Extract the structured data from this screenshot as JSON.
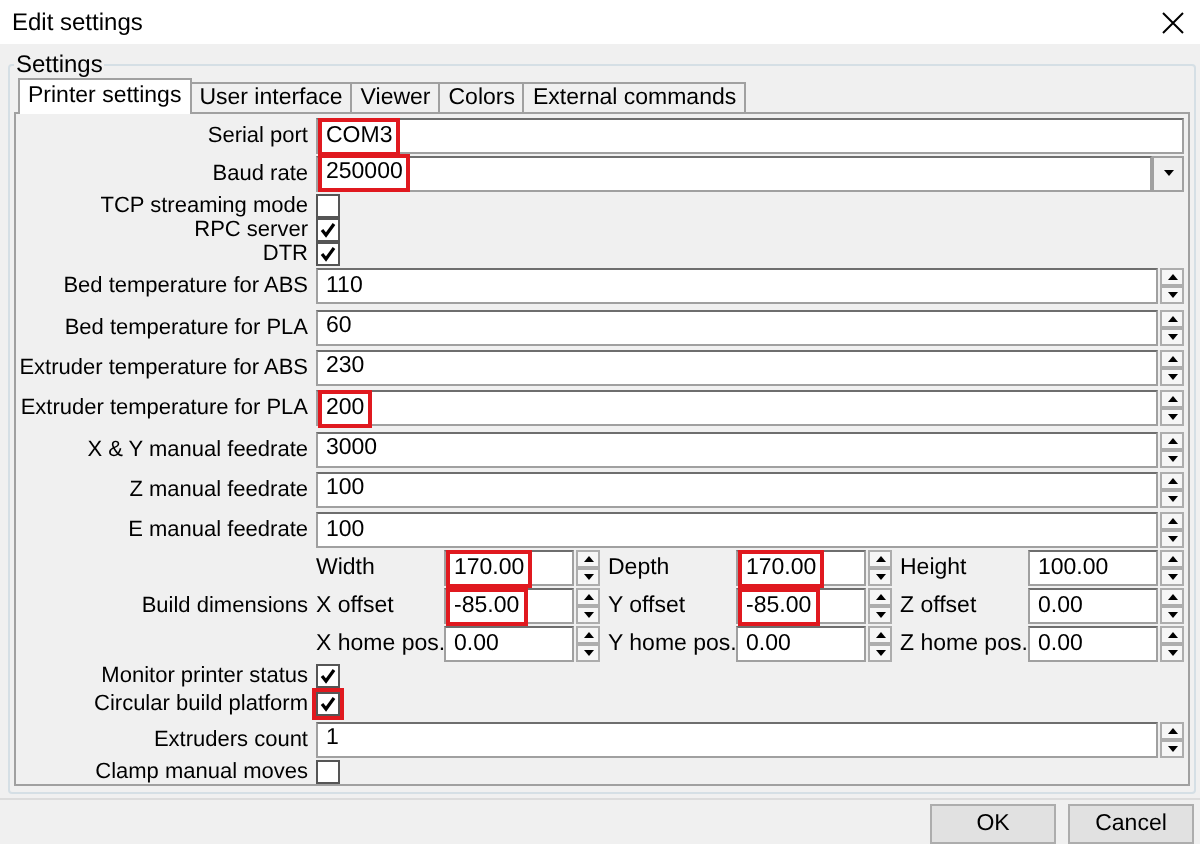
{
  "window": {
    "title": "Edit settings"
  },
  "group": {
    "title": "Settings"
  },
  "tabs": [
    {
      "label": "Printer settings",
      "selected": true
    },
    {
      "label": "User interface",
      "selected": false
    },
    {
      "label": "Viewer",
      "selected": false
    },
    {
      "label": "Colors",
      "selected": false
    },
    {
      "label": "External commands",
      "selected": false
    }
  ],
  "rows": [
    {
      "kind": "text",
      "label": "Serial port",
      "value": "COM3",
      "highlighted": true
    },
    {
      "kind": "combo",
      "label": "Baud rate",
      "value": "250000",
      "highlighted": true
    },
    {
      "kind": "check",
      "label": "TCP streaming mode",
      "checked": false,
      "highlighted": false
    },
    {
      "kind": "check",
      "label": "RPC server",
      "checked": true,
      "highlighted": false
    },
    {
      "kind": "check",
      "label": "DTR",
      "checked": true,
      "highlighted": false
    },
    {
      "kind": "spin",
      "label": "Bed temperature for ABS",
      "value": "110",
      "highlighted": false
    },
    {
      "kind": "spin",
      "label": "Bed temperature for PLA",
      "value": "60",
      "highlighted": false
    },
    {
      "kind": "spin",
      "label": "Extruder temperature for ABS",
      "value": "230",
      "highlighted": false
    },
    {
      "kind": "spin",
      "label": "Extruder temperature for PLA",
      "value": "200",
      "highlighted": true
    },
    {
      "kind": "spin",
      "label": "X & Y manual feedrate",
      "value": "3000",
      "highlighted": false
    },
    {
      "kind": "spin",
      "label": "Z manual feedrate",
      "value": "100",
      "highlighted": false
    },
    {
      "kind": "spin",
      "label": "E manual feedrate",
      "value": "100",
      "highlighted": false
    },
    {
      "kind": "dimensions",
      "label": "Build dimensions",
      "cells": [
        {
          "label": "Width",
          "value": "170.00",
          "highlighted": true
        },
        {
          "label": "Depth",
          "value": "170.00",
          "highlighted": true
        },
        {
          "label": "Height",
          "value": "100.00",
          "highlighted": false
        },
        {
          "label": "X offset",
          "value": "-85.00",
          "highlighted": true
        },
        {
          "label": "Y offset",
          "value": "-85.00",
          "highlighted": true
        },
        {
          "label": "Z offset",
          "value": "0.00",
          "highlighted": false
        },
        {
          "label": "X home pos.",
          "value": "0.00",
          "highlighted": false
        },
        {
          "label": "Y home pos.",
          "value": "0.00",
          "highlighted": false
        },
        {
          "label": "Z home pos.",
          "value": "0.00",
          "highlighted": false
        }
      ]
    },
    {
      "kind": "check",
      "label": "Monitor printer status",
      "checked": true,
      "highlighted": false
    },
    {
      "kind": "check",
      "label": "Circular build platform",
      "checked": true,
      "highlighted": true
    },
    {
      "kind": "spin",
      "label": "Extruders count",
      "value": "1",
      "highlighted": false
    },
    {
      "kind": "check",
      "label": "Clamp manual moves",
      "checked": false,
      "highlighted": false
    }
  ],
  "buttons": [
    {
      "label": "OK"
    },
    {
      "label": "Cancel"
    }
  ]
}
